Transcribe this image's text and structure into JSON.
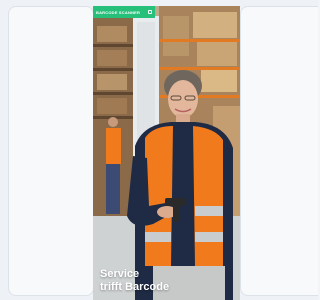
{
  "ad": {
    "brand_label": "BARCODE SCANNER",
    "headline_line1": "Service",
    "headline_line2": "trifft Barcode"
  },
  "colors": {
    "brand_green": "#27c07a",
    "vest_orange": "#f07a1c",
    "page_bg": "#eef1f5"
  },
  "icons": {
    "brand_mark": "brand-mark-icon"
  }
}
